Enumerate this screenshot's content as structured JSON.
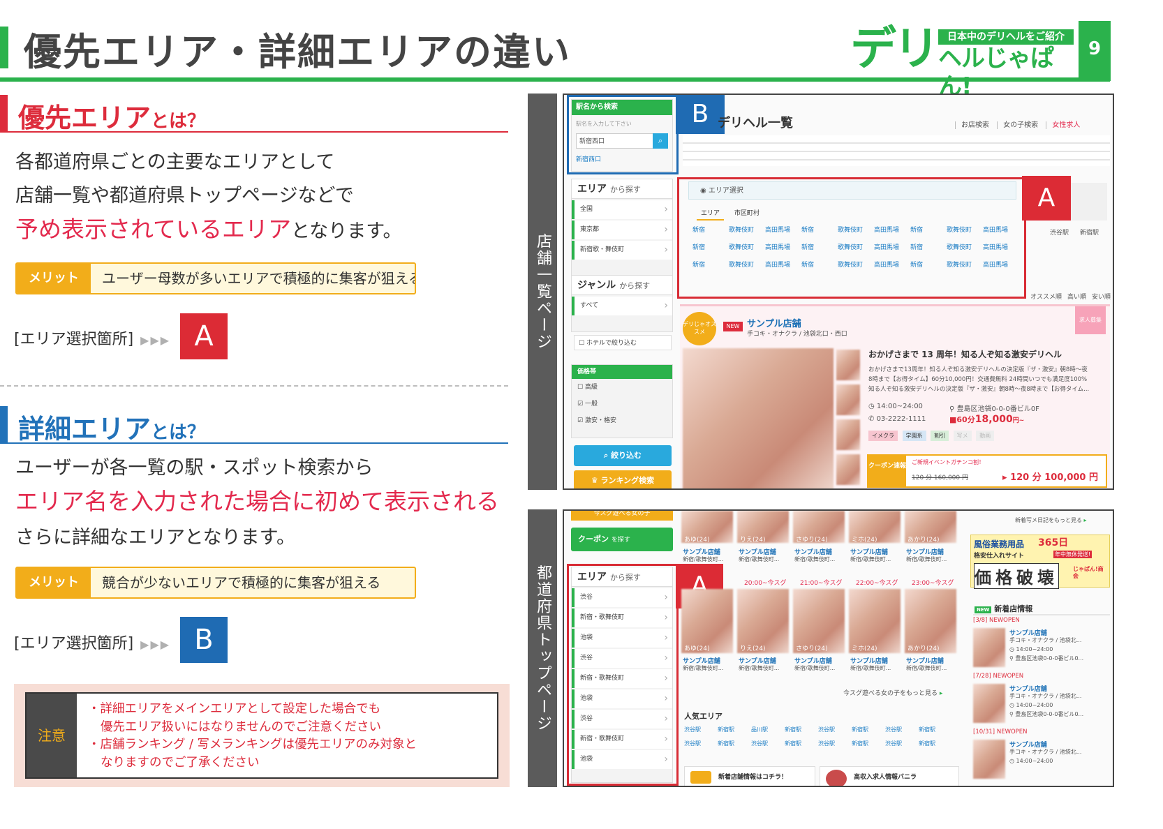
{
  "header": {
    "title": "優先エリア・詳細エリアの違い",
    "logo_big": "デリ",
    "logo_tag": "日本中のデリヘルをご紹介",
    "logo_sub": "ヘルじゃぱん!",
    "page_number": "9"
  },
  "priority": {
    "heading": "優先エリア",
    "heading_suffix": "とは？",
    "line1": "各都道府県ごとの主要なエリアとして",
    "line2": "店舗一覧や都道府県トップページなどで",
    "line3_highlight": "予め表示されているエリア",
    "line3_rest": "となります。",
    "merit_tag": "メリット",
    "merit_text": "ユーザー母数が多いエリアで積極的に集客が狙える",
    "select_label": "[エリア選択箇所]",
    "select_arrows": "▶▶▶",
    "badge": "A"
  },
  "detail": {
    "heading": "詳細エリア",
    "heading_suffix": "とは？",
    "line1": "ユーザーが各一覧の駅・スポット検索から",
    "line2_highlight": "エリア名を入力された場合に初めて表示される",
    "line3": "さらに詳細なエリアとなります。",
    "merit_tag": "メリット",
    "merit_text": "競合が少ないエリアで積極的に集客が狙える",
    "select_label": "[エリア選択箇所]",
    "select_arrows": "▶▶▶",
    "badge": "B"
  },
  "caution": {
    "tag": "注意",
    "line1": "・詳細エリアをメインエリアとして設定した場合でも",
    "line2": "優先エリア扱いにはなりませんのでご注意ください",
    "line3": "・店舗ランキング / 写メランキングは優先エリアのみ対象と",
    "line4": "なりますのでご了承ください"
  },
  "screenshot1": {
    "side_label": "店舗一覧ページ",
    "station_search": "駅名から検索",
    "station_placeholder": "駅名を入力して下さい",
    "station_value": "新宿西口",
    "station_link": "新宿西口",
    "list_title": "デリヘル一覧",
    "tabs": [
      "お店検索",
      "女の子検索",
      "女性求人"
    ],
    "area_box_title": "エリア選択",
    "area_tab1": "エリア",
    "area_tab2": "市区町村",
    "area_links": [
      "新宿",
      "歌舞伎町",
      "高田馬場",
      "新宿",
      "歌舞伎町",
      "高田馬場",
      "新宿",
      "歌舞伎町",
      "高田馬場"
    ],
    "side_area_head": "エリア",
    "side_area_sub": "から探す",
    "side_area_items": [
      "全国",
      "東京都",
      "新宿歌・舞伎町"
    ],
    "side_genre_head": "ジャンル",
    "side_genre_sub": "から探す",
    "side_genre_items": [
      "すべて"
    ],
    "hotel_check": "ホテルで絞り込む",
    "price_head": "価格帯",
    "price_items": [
      "高級",
      "一般",
      "激安・格安"
    ],
    "narrow_btn": "絞り込む",
    "ranking_btn": "ランキング検索",
    "shop_name": "サンプル店舗",
    "shop_meta": "手コキ・オナクラ / 池袋北口・西口",
    "shop_headline": "おかげさまで 13 周年！知る人ぞ知る激安デリヘル",
    "shop_desc1": "おかげさまで13周年！知る人ぞ知る激安デリヘルの決定版『ザ・激安』朝8時～夜",
    "shop_desc2": "8時まで【お得タイム】60分10,000円！交通費無料 24時間いつでも満足度100%",
    "shop_desc3": "知る人ぞ知る激安デリヘルの決定版『ザ・激安』朝8時～夜8時まで【お得タイム...",
    "shop_hours": "14:00~24:00",
    "shop_address": "豊島区池袋0-0-0番ビル0F",
    "shop_phone": "03-2222-1111",
    "shop_price_label": "60分",
    "shop_price": "18,000",
    "shop_price_suffix": "円~",
    "coupon_label": "クーポン速報",
    "coupon_event": "ご新規イベントガチンコ割！",
    "coupon_old": "120 分 160,000 円",
    "coupon_new": "120 分 100,000 円",
    "new_badge": "NEW",
    "recommend_badge": "デリじゃオススメ",
    "feature_tags": [
      "イメクラ",
      "学園系",
      "割引",
      "写メ",
      "動画"
    ],
    "sort_labels": [
      "オススメ順",
      "高い順",
      "安い順"
    ],
    "mini_stations": [
      "渋谷駅",
      "新宿駅"
    ],
    "recruit_label": "求人募集"
  },
  "screenshot2": {
    "side_label": "都道府県トップページ",
    "coupon_btn": "クーポン",
    "coupon_btn_sub": "を探す",
    "side_area_head": "エリア",
    "side_area_sub": "から探す",
    "side_area_items": [
      "渋谷",
      "新宿・歌舞伎町",
      "池袋",
      "渋谷",
      "新宿・歌舞伎町",
      "池袋",
      "渋谷",
      "新宿・歌舞伎町",
      "池袋"
    ],
    "girls_row1": [
      "あゆ(24)",
      "りえ(24)",
      "さゆり(24)",
      "ミホ(24)",
      "あかり(24)"
    ],
    "girls_row2": [
      "あゆ(24)",
      "りえ(24)",
      "さゆり(24)",
      "ミホ(24)",
      "あかり(24)"
    ],
    "girl_shop": "サンプル店舗",
    "girl_area": "新宿/歌舞伎町...",
    "times": [
      "20:00~今スグ",
      "21:00~今スグ",
      "22:00~今スグ",
      "23:00~今スグ"
    ],
    "more_girls": "今スグ遊べる女の子をもっと見る",
    "popular_area": "人気エリア",
    "popular_stations": [
      "渋谷駅",
      "新宿駅",
      "品川駅",
      "新宿駅",
      "渋谷駅",
      "新宿駅",
      "渋谷駅",
      "新宿駅",
      "渋谷駅",
      "新宿駅",
      "渋谷駅",
      "新宿駅",
      "渋谷駅",
      "新宿駅",
      "渋谷駅",
      "新宿駅"
    ],
    "new_shop_banner": "新着店舗情報はコチラ！",
    "recruit_banner": "高収入求人情報バニラ",
    "right_more": "新着写メ日記をもっと見る",
    "ad_line1": "風俗業務用品",
    "ad_365": "365日",
    "ad_line2": "格安仕入れサイト",
    "ad_line3": "年中無休発送!",
    "ad_big": "価格破壊",
    "ad_brand": "じゃぱん!商会",
    "new_shop_head": "新着店情報",
    "new_entries": [
      {
        "date": "[3/8]",
        "tag": "NEWOPEN",
        "name": "サンプル店舗",
        "meta": "手コキ・オナクラ / 池袋北...",
        "hours": "14:00~24:00",
        "addr": "豊島区池袋0-0-0番ビル0..."
      },
      {
        "date": "[7/28]",
        "tag": "NEWOPEN",
        "name": "サンプル店舗",
        "meta": "手コキ・オナクラ / 池袋北...",
        "hours": "14:00~24:00",
        "addr": "豊島区池袋0-0-0番ビル0..."
      },
      {
        "date": "[10/31]",
        "tag": "NEWOPEN",
        "name": "サンプル店舗",
        "meta": "手コキ・オナクラ / 池袋北...",
        "hours": "14:00~24:00",
        "addr": ""
      }
    ],
    "top_cut_label": "今スグ遊べる女の子"
  },
  "colors": {
    "green": "#2bb24c",
    "red": "#dd2c3c",
    "blue": "#2272b9",
    "orange": "#f2ad1a"
  }
}
